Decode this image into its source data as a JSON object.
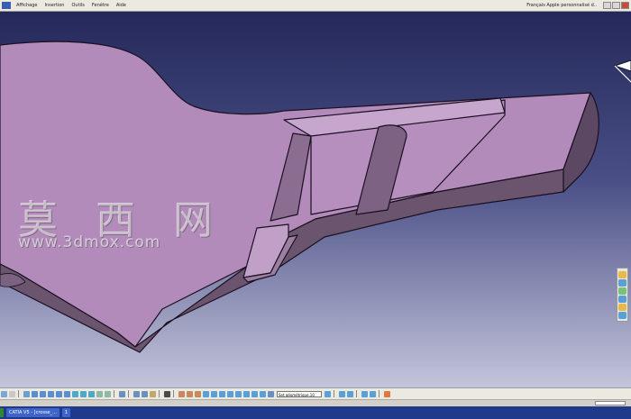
{
  "menubar": {
    "items": [
      "Affichage",
      "Insertion",
      "Outils",
      "Fenêtre",
      "Aide"
    ],
    "right_text": "Français Apple personnalisé d.."
  },
  "viewport": {
    "background_top": "#262a5c",
    "background_bottom": "#b6b8d4",
    "part_color": "#b28bbb",
    "edge_color": "#1a1020",
    "shade_color": "#6d5670"
  },
  "watermark": {
    "text": "莫 西 网",
    "url": "www.3dmox.com"
  },
  "toolbar": {
    "set_dropdown": "Set géométrique.10"
  },
  "taskbar": {
    "items": [
      "CATIA V5 - [crosse_...",
      "1"
    ]
  },
  "icons": [
    "window-minimize-icon",
    "window-maximize-icon",
    "window-close-icon",
    "compass-icon",
    "sketch-icon",
    "view-icon"
  ]
}
